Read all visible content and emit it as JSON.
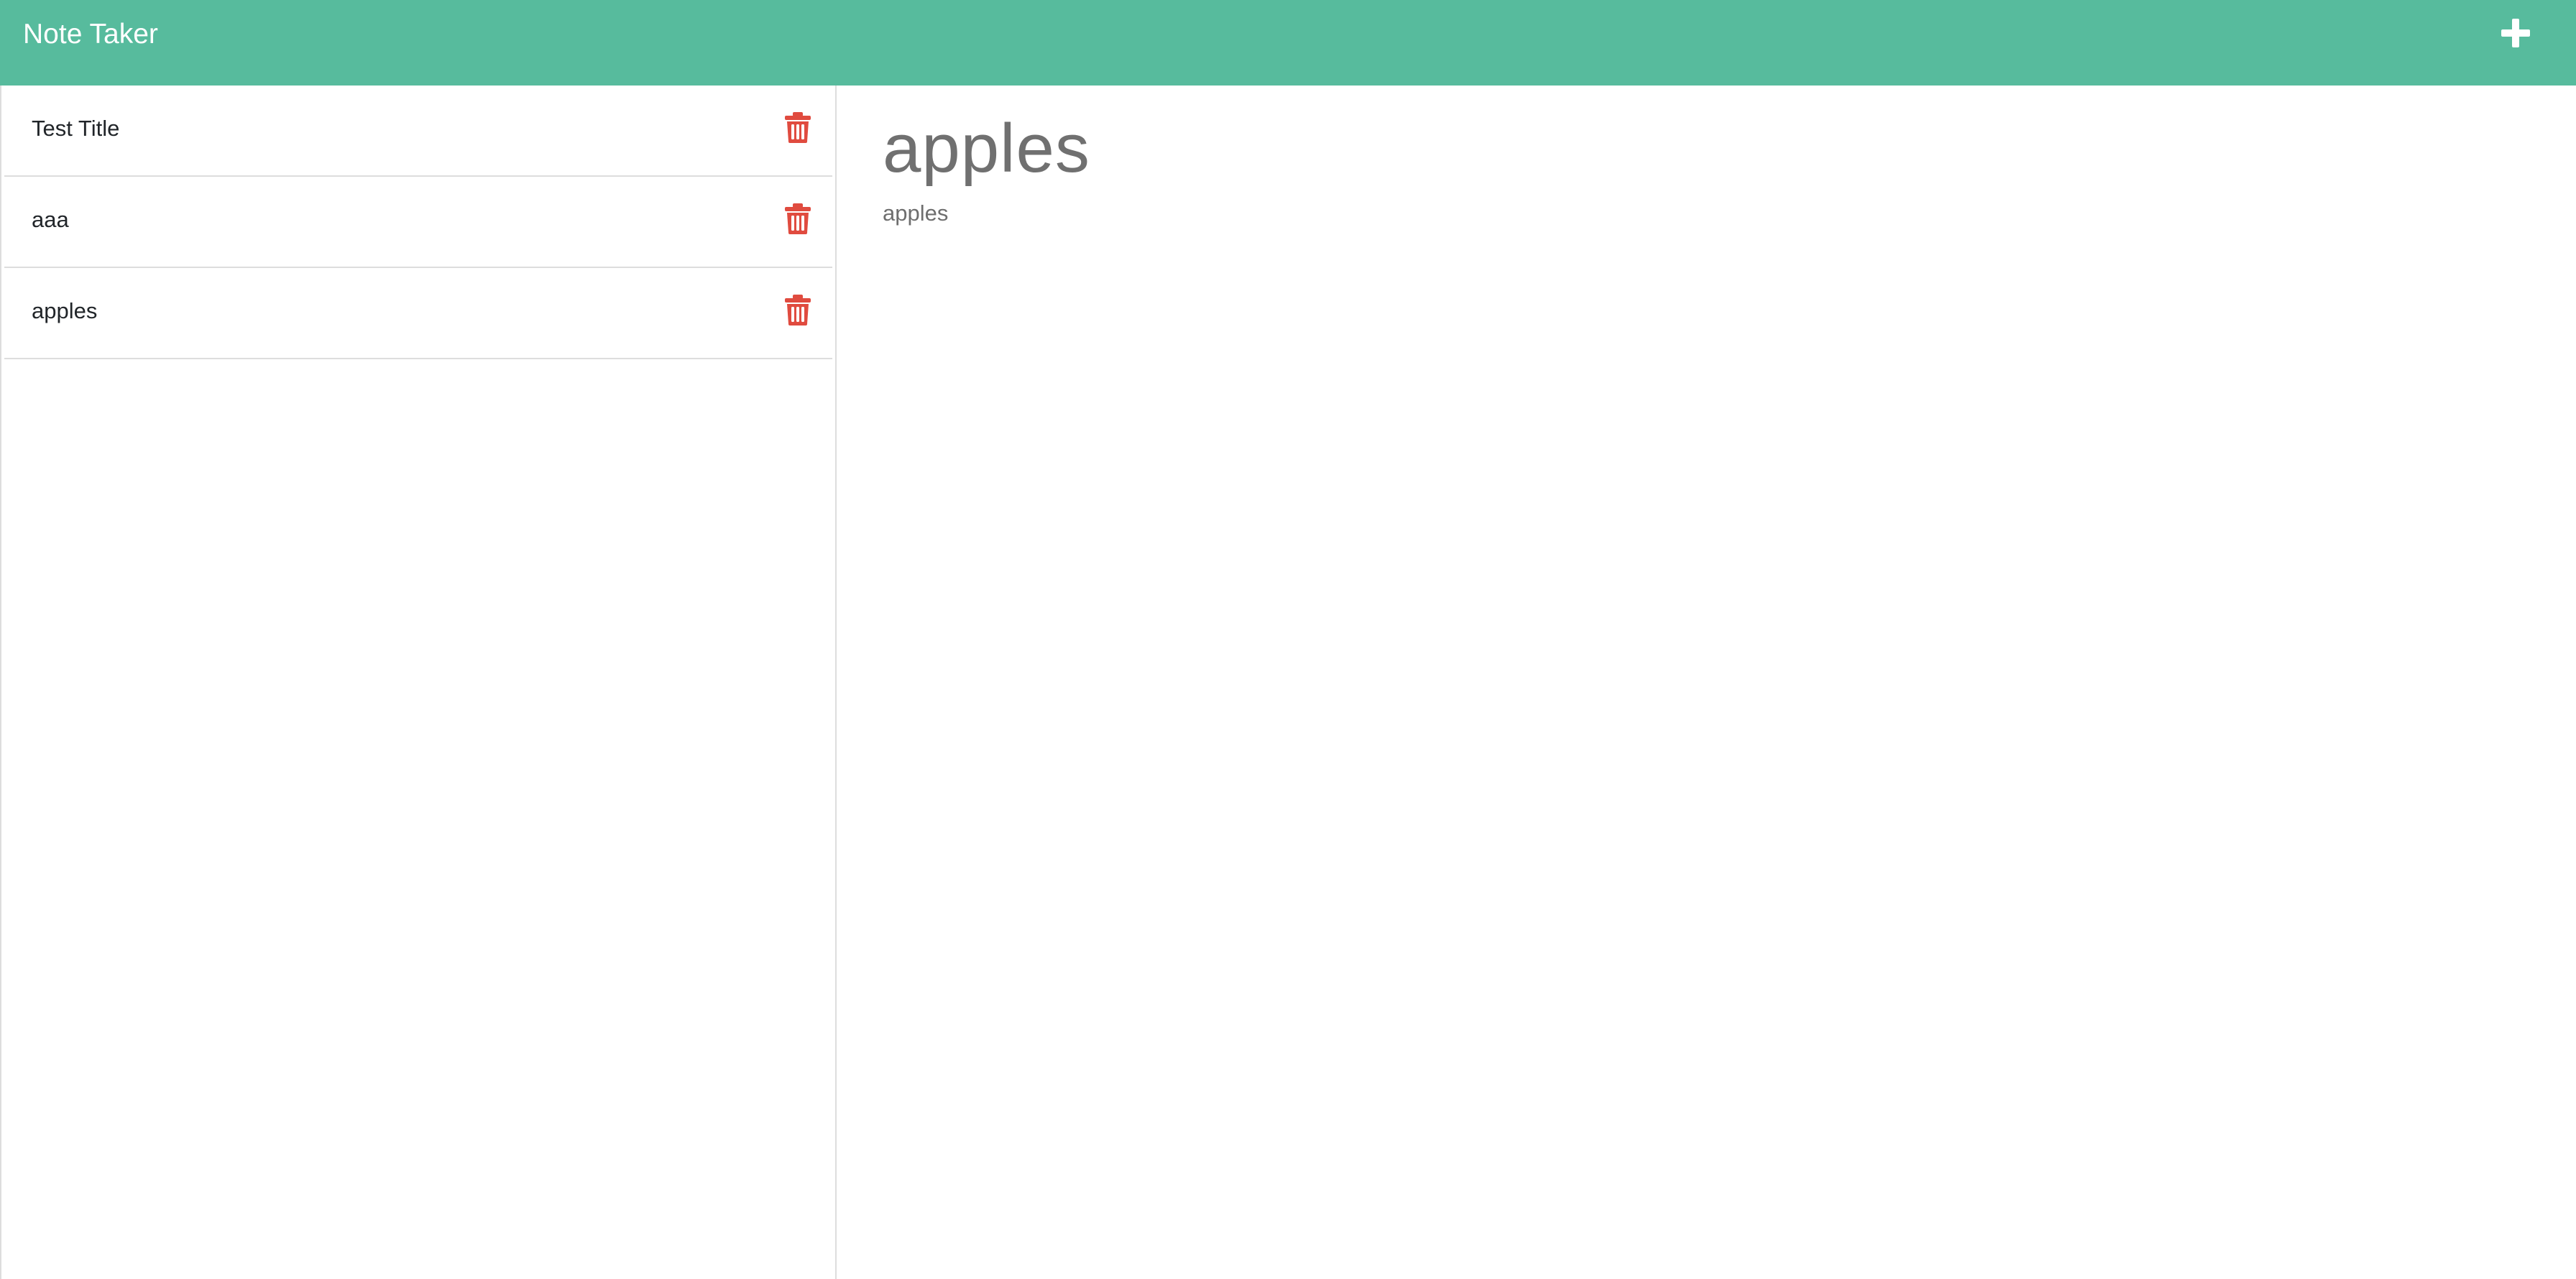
{
  "header": {
    "app_title": "Note Taker",
    "new_note_icon": "plus-icon",
    "background_color": "#57bb9d"
  },
  "sidebar": {
    "notes": [
      {
        "title": "Test Title",
        "delete_icon": "trash-icon"
      },
      {
        "title": "aaa",
        "delete_icon": "trash-icon"
      },
      {
        "title": "apples",
        "delete_icon": "trash-icon"
      }
    ],
    "delete_icon_color": "#e04b3f"
  },
  "editor": {
    "title": "apples",
    "body": "apples"
  }
}
